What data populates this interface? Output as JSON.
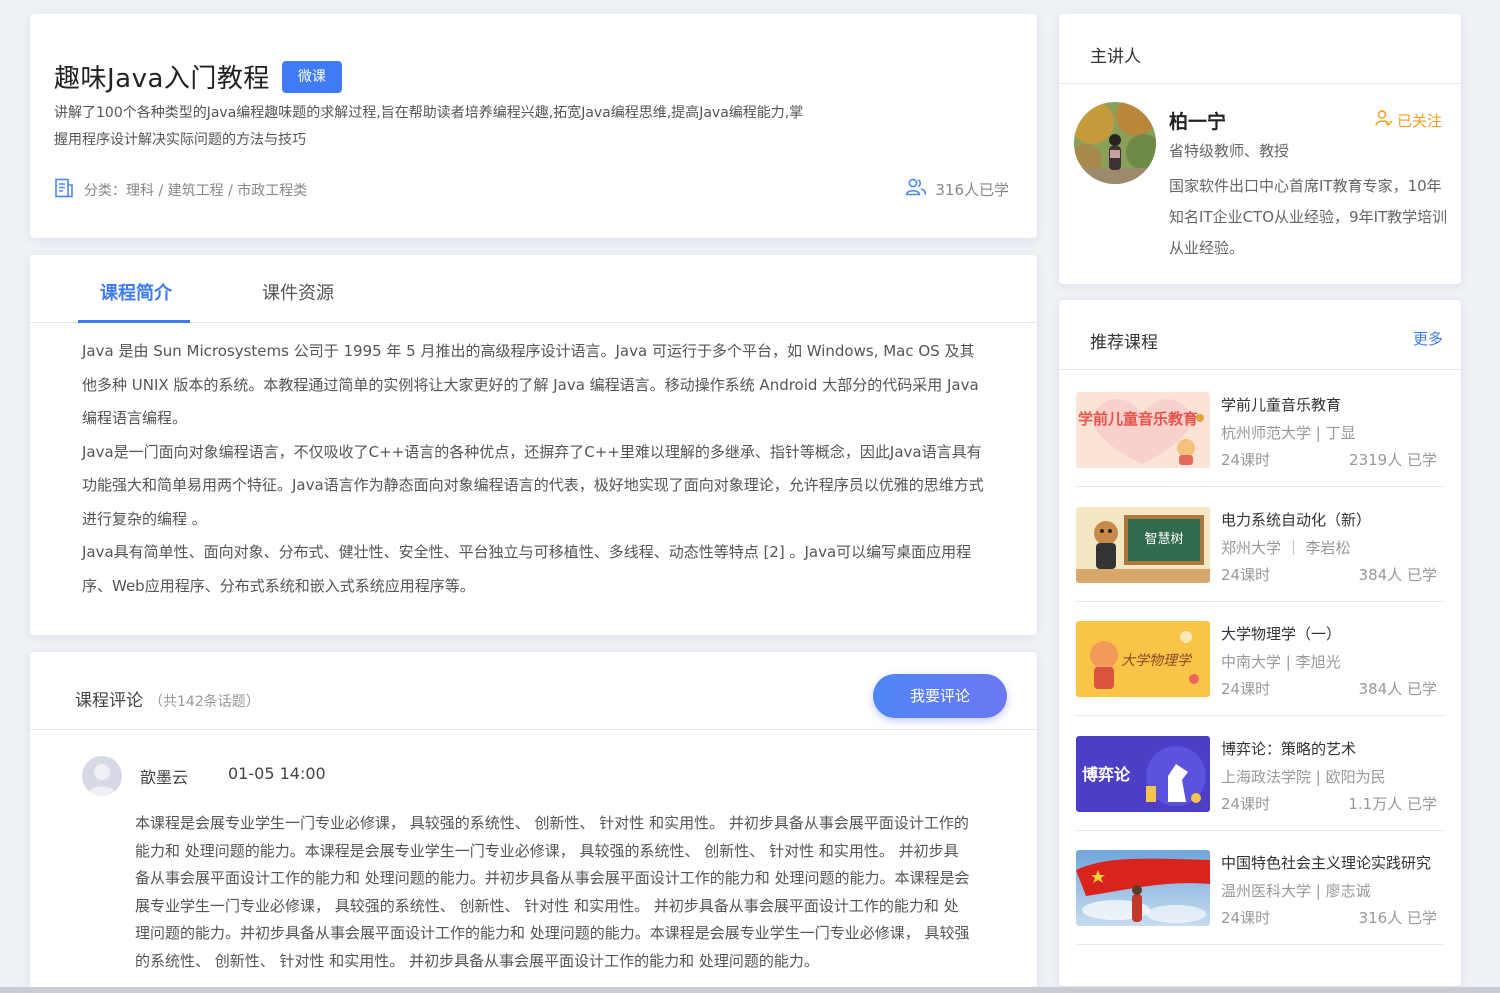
{
  "course": {
    "title": "趣味Java入门教程",
    "badge": "微课",
    "description": "讲解了100个各种类型的Java编程趣味题的求解过程,旨在帮助读者培养编程兴趣,拓宽Java编程思维,提高Java编程能力,掌握用程序设计解决实际问题的方法与技巧",
    "category": "分类：理科 / 建筑工程 / 市政工程类",
    "learners": "316人已学"
  },
  "tabs": [
    {
      "label": "课程简介",
      "active": true
    },
    {
      "label": "课件资源",
      "active": false
    }
  ],
  "intro": {
    "paragraphs": [
      "Java 是由 Sun Microsystems 公司于 1995 年 5 月推出的高级程序设计语言。Java 可运行于多个平台，如 Windows, Mac OS 及其他多种 UNIX 版本的系统。本教程通过简单的实例将让大家更好的了解 Java 编程语言。移动操作系统 Android 大部分的代码采用 Java 编程语言编程。",
      "Java是一门面向对象编程语言，不仅吸收了C++语言的各种优点，还摒弃了C++里难以理解的多继承、指针等概念，因此Java语言具有功能强大和简单易用两个特征。Java语言作为静态面向对象编程语言的代表，极好地实现了面向对象理论，允许程序员以优雅的思维方式进行复杂的编程 。",
      "Java具有简单性、面向对象、分布式、健壮性、安全性、平台独立与可移植性、多线程、动态性等特点 [2] 。Java可以编写桌面应用程序、Web应用程序、分布式系统和嵌入式系统应用程序等。"
    ]
  },
  "comments": {
    "title": "课程评论",
    "count": "（共142条话题）",
    "button": "我要评论",
    "items": [
      {
        "user": "歆墨云",
        "time": "01-05 14:00",
        "text": "本课程是会展专业学生一门专业必修课， 具较强的系统性、 创新性、 针对性 和实用性。 并初步具备从事会展平面设计工作的能力和 处理问题的能力。本课程是会展专业学生一门专业必修课， 具较强的系统性、 创新性、 针对性 和实用性。 并初步具备从事会展平面设计工作的能力和 处理问题的能力。并初步具备从事会展平面设计工作的能力和 处理问题的能力。本课程是会展专业学生一门专业必修课， 具较强的系统性、 创新性、 针对性 和实用性。 并初步具备从事会展平面设计工作的能力和 处理问题的能力。并初步具备从事会展平面设计工作的能力和 处理问题的能力。本课程是会展专业学生一门专业必修课， 具较强的系统性、 创新性、 针对性 和实用性。 并初步具备从事会展平面设计工作的能力和 处理问题的能力。"
      }
    ]
  },
  "lecturer": {
    "section_title": "主讲人",
    "name": "柏一宁",
    "follow": "已关注",
    "titles": "省特级教师、教授",
    "bio": "国家软件出口中心首席IT教育专家，10年知名IT企业CTO从业经验，9年IT教学培训从业经验。"
  },
  "recommend": {
    "section_title": "推荐课程",
    "more": "更多",
    "items": [
      {
        "title": "学前儿童音乐教育",
        "school": "杭州师范大学 | 丁显",
        "hours": "24课时",
        "learners": "2319人 已学",
        "thumb_text": "学前儿童音乐教育"
      },
      {
        "title": "电力系统自动化（新）",
        "school": "郑州大学 ｜ 李岩松",
        "hours": "24课时",
        "learners": "384人 已学",
        "thumb_text": "智慧树"
      },
      {
        "title": "大学物理学（一）",
        "school": "中南大学 | 李旭光",
        "hours": "24课时",
        "learners": "384人 已学",
        "thumb_text": "大学物理学"
      },
      {
        "title": "博弈论：策略的艺术",
        "school": "上海政法学院 | 欧阳为民",
        "hours": "24课时",
        "learners": "1.1万人 已学",
        "thumb_text": "博弈论"
      },
      {
        "title": "中国特色社会主义理论实践研究",
        "school": "温州医科大学 | 廖志诚",
        "hours": "24课时",
        "learners": "316人 已学",
        "thumb_text": ""
      }
    ]
  },
  "icons": {
    "category": "document-icon",
    "learners": "users-icon",
    "follow": "user-check-icon"
  },
  "colors": {
    "accent": "#3e7bf5",
    "follow": "#f29c1f",
    "background": "#eef1f6"
  }
}
